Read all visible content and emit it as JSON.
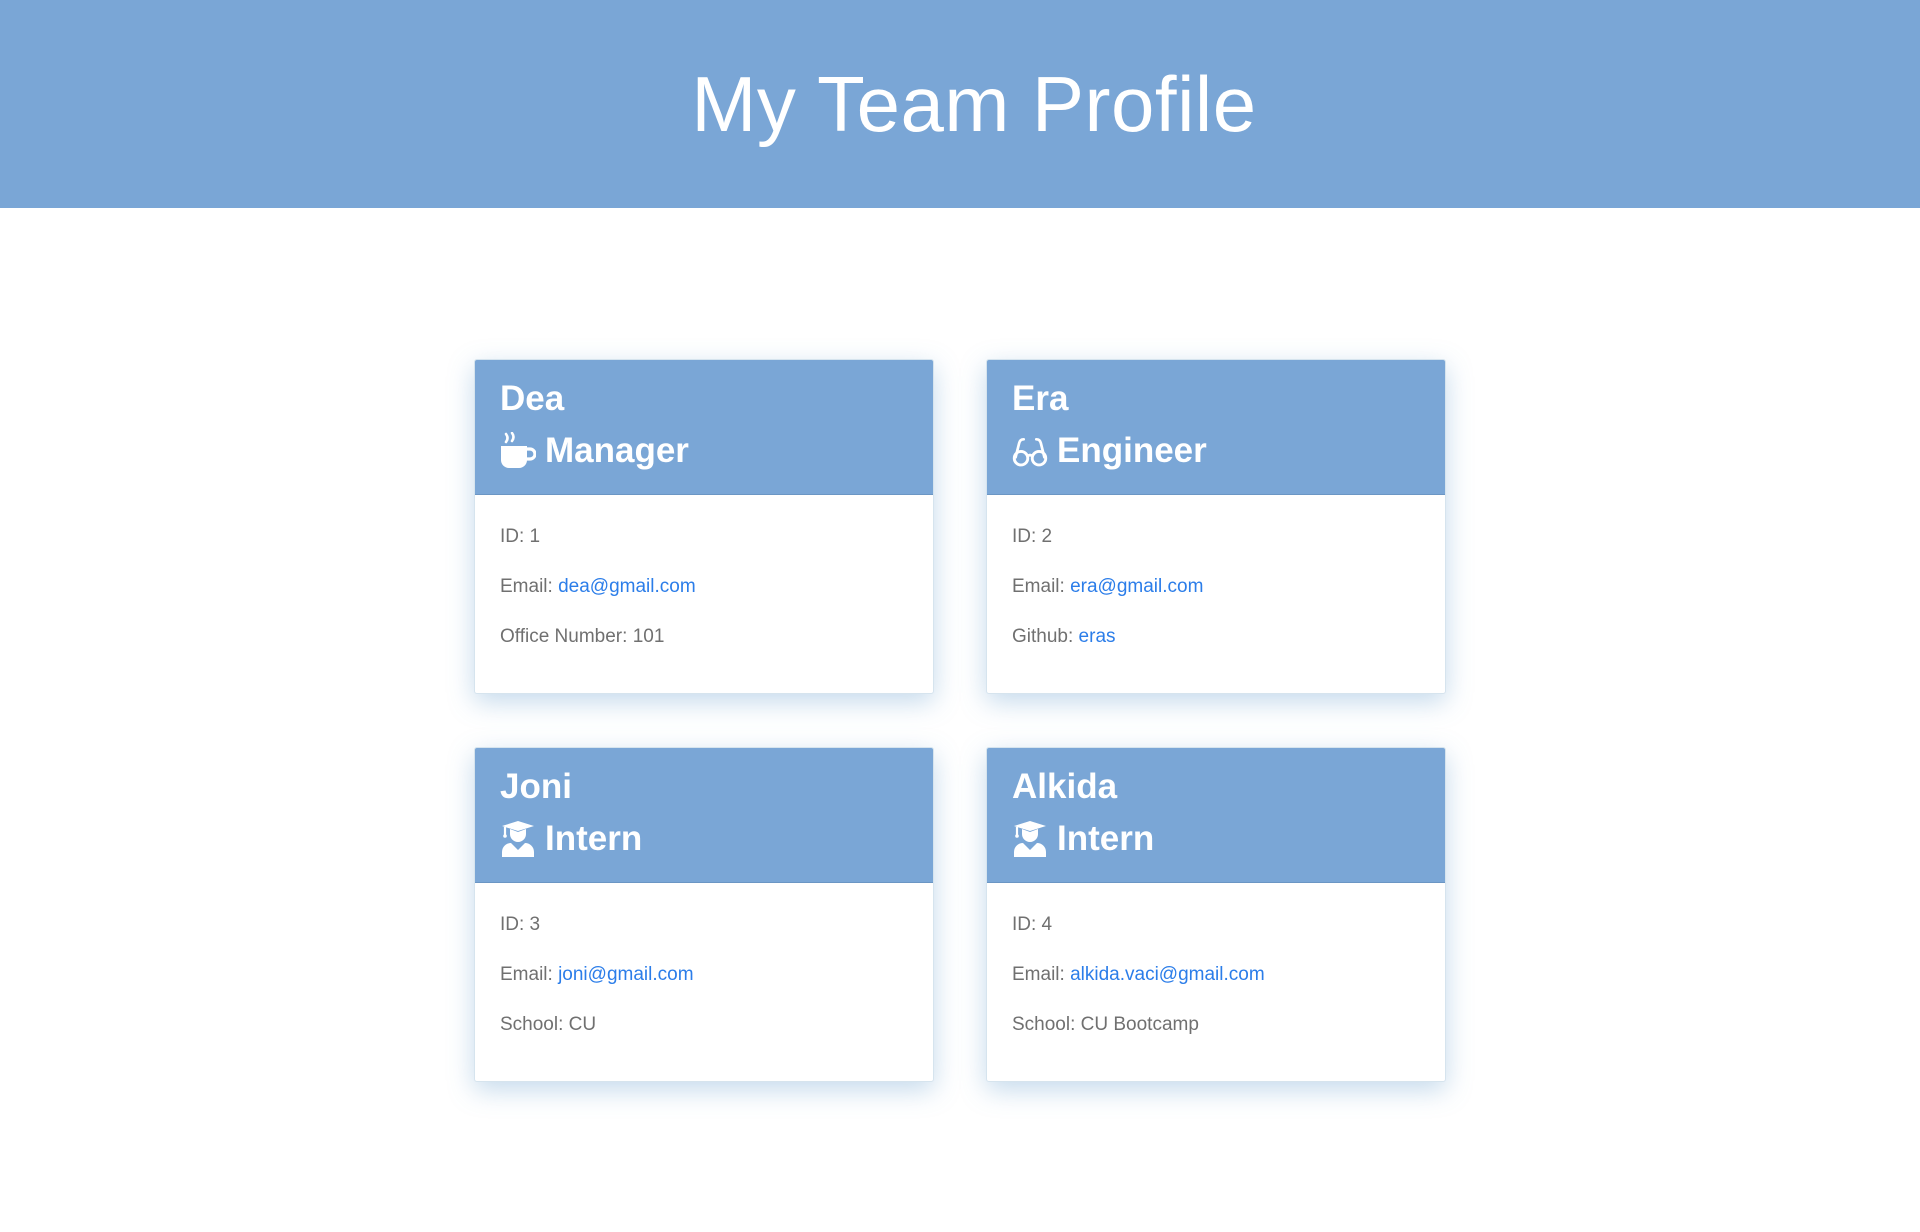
{
  "header": {
    "title": "My Team Profile"
  },
  "colors": {
    "header_bg": "#7aa6d6",
    "link": "#2b7de9",
    "body_text": "#707070"
  },
  "cards": [
    {
      "name": "Dea",
      "role": "Manager",
      "icon": "mug-icon",
      "id_label": "ID: 1",
      "email_label": "Email:",
      "email": "dea@gmail.com",
      "extra_label": "Office Number: 101",
      "extra_link": ""
    },
    {
      "name": "Era",
      "role": "Engineer",
      "icon": "glasses-icon",
      "id_label": "ID: 2",
      "email_label": "Email:",
      "email": "era@gmail.com",
      "extra_label": "Github:",
      "extra_link": "eras"
    },
    {
      "name": "Joni",
      "role": "Intern",
      "icon": "graduate-icon",
      "id_label": "ID: 3",
      "email_label": "Email:",
      "email": "joni@gmail.com",
      "extra_label": "School: CU",
      "extra_link": ""
    },
    {
      "name": "Alkida",
      "role": "Intern",
      "icon": "graduate-icon",
      "id_label": "ID: 4",
      "email_label": "Email:",
      "email": "alkida.vaci@gmail.com",
      "extra_label": "School: CU Bootcamp",
      "extra_link": ""
    }
  ]
}
